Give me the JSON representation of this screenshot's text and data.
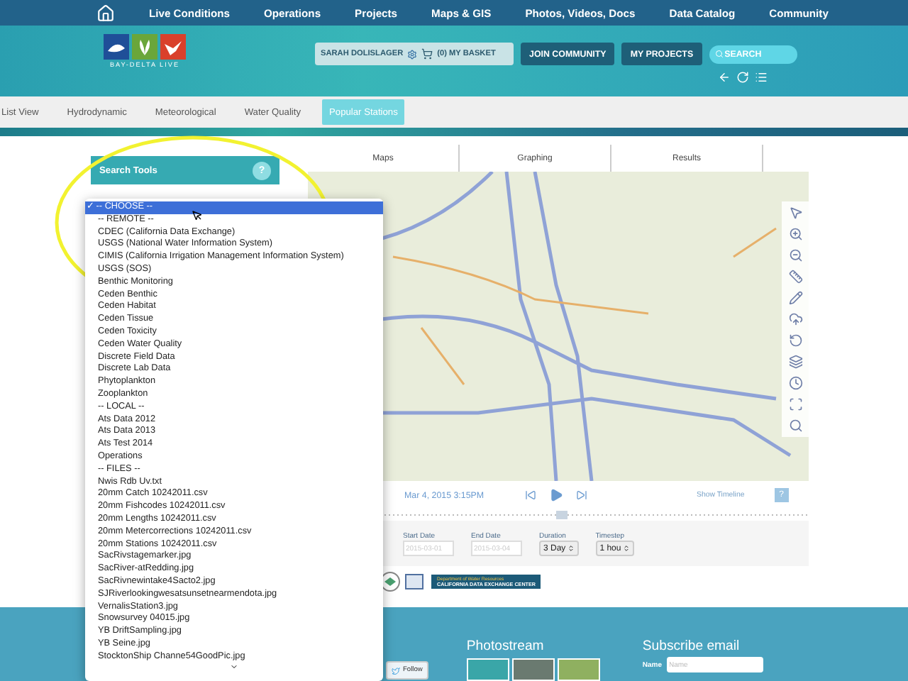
{
  "top_nav": {
    "items": [
      "Live Conditions",
      "Operations",
      "Projects",
      "Maps & GIS",
      "Photos, Videos, Docs",
      "Data Catalog",
      "Community"
    ]
  },
  "header": {
    "logo_text": "BAY-DELTA LIVE",
    "user": "SARAH DOLISLAGER",
    "basket": "(0) MY BASKET",
    "buttons": [
      "JOIN COMMUNITY",
      "MY PROJECTS"
    ],
    "search": {
      "placeholder": "SEARCH"
    }
  },
  "tabs": [
    {
      "label": "List View",
      "selected": false
    },
    {
      "label": "Hydrodynamic",
      "selected": false
    },
    {
      "label": "Meteorological",
      "selected": false
    },
    {
      "label": "Water Quality",
      "selected": false
    },
    {
      "label": "Popular Stations",
      "selected": true
    }
  ],
  "search_tools": {
    "title": "Search Tools",
    "help": "?"
  },
  "dropdown": {
    "check": "✓",
    "options": [
      {
        "label": "-- CHOOSE --",
        "selected": true
      },
      {
        "label": "-- REMOTE --",
        "selected": false
      },
      {
        "label": "CDEC (California Data Exchange)",
        "selected": false
      },
      {
        "label": "USGS (National Water Information System)",
        "selected": false
      },
      {
        "label": "CIMIS (California Irrigation Management Information System)",
        "selected": false
      },
      {
        "label": "USGS (SOS)",
        "selected": false
      },
      {
        "label": "Benthic Monitoring",
        "selected": false
      },
      {
        "label": "Ceden Benthic",
        "selected": false
      },
      {
        "label": "Ceden Habitat",
        "selected": false
      },
      {
        "label": "Ceden Tissue",
        "selected": false
      },
      {
        "label": "Ceden Toxicity",
        "selected": false
      },
      {
        "label": "Ceden Water Quality",
        "selected": false
      },
      {
        "label": "Discrete Field Data",
        "selected": false
      },
      {
        "label": "Discrete Lab Data",
        "selected": false
      },
      {
        "label": "Phytoplankton",
        "selected": false
      },
      {
        "label": "Zooplankton",
        "selected": false
      },
      {
        "label": "-- LOCAL --",
        "selected": false
      },
      {
        "label": "Ats Data 2012",
        "selected": false
      },
      {
        "label": "Ats Data 2013",
        "selected": false
      },
      {
        "label": "Ats Test 2014",
        "selected": false
      },
      {
        "label": "Operations",
        "selected": false
      },
      {
        "label": "-- FILES --",
        "selected": false
      },
      {
        "label": "Nwis Rdb Uv.txt",
        "selected": false
      },
      {
        "label": "20mm Catch 10242011.csv",
        "selected": false
      },
      {
        "label": "20mm Fishcodes 10242011.csv",
        "selected": false
      },
      {
        "label": "20mm Lengths 10242011.csv",
        "selected": false
      },
      {
        "label": "20mm Metercorrections 10242011.csv",
        "selected": false
      },
      {
        "label": "20mm Stations 10242011.csv",
        "selected": false
      },
      {
        "label": "SacRivstagemarker.jpg",
        "selected": false
      },
      {
        "label": "SacRiver-atRedding.jpg",
        "selected": false
      },
      {
        "label": "SacRivnewintake4Sacto2.jpg",
        "selected": false
      },
      {
        "label": "SJRiverlookingwesatsunsetnearmendota.jpg",
        "selected": false
      },
      {
        "label": "VernalisStation3.jpg",
        "selected": false
      },
      {
        "label": "Snowsurvey 04015.jpg",
        "selected": false
      },
      {
        "label": "YB DriftSampling.jpg",
        "selected": false
      },
      {
        "label": "YB Seine.jpg",
        "selected": false
      },
      {
        "label": "StocktonShip Channe54GoodPic.jpg",
        "selected": false
      }
    ]
  },
  "view_tabs": [
    "Maps",
    "Graphing",
    "Results"
  ],
  "timeline": {
    "datetime": "Mar 4, 2015 3:15PM",
    "show_timeline": "Show Timeline",
    "help": "?"
  },
  "filters": {
    "start_date": {
      "label": "Start Date",
      "placeholder": "2015-03-01"
    },
    "end_date": {
      "label": "End Date",
      "placeholder": "2015-03-04"
    },
    "duration": {
      "label": "Duration",
      "value": "3 Day"
    },
    "timestep": {
      "label": "Timestep",
      "value": "1 hou"
    }
  },
  "partner_banner": {
    "line_1": "Department of Water Resources",
    "line_2": "CALIFORNIA DATA EXCHANGE CENTER"
  },
  "footer": {
    "follow": "Follow",
    "photostream": "Photostream",
    "subscribe": {
      "title": "Subscribe email",
      "name_label": "Name",
      "name_placeholder": "Name"
    }
  }
}
